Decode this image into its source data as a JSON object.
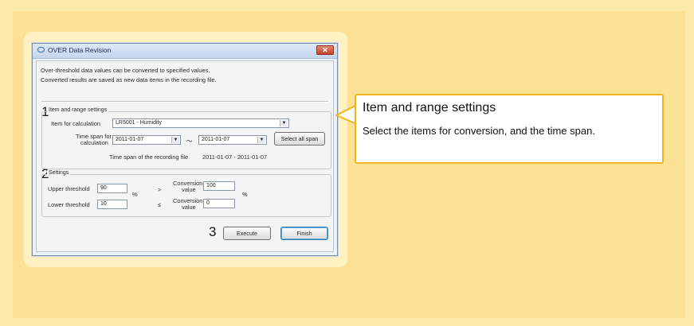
{
  "window": {
    "title": "OVER Data Revision",
    "close_glyph": "✕",
    "intro_line1": "Over-threshold data values can be converted to specified values.",
    "intro_line2": "Converted results are saved as new data items in the recording file."
  },
  "item_range": {
    "step": "1",
    "group_title": "Item and range settings",
    "calc_label": "Item for calculation",
    "calc_value": "LR5001 - Humidity",
    "span_label_1": "Time span for",
    "span_label_2": "calculation",
    "start_date": "2011-01-07",
    "tilde": "〜",
    "end_date": "2011-01-07",
    "select_all_label": "Select all span",
    "recording_span_label": "Time span of the recording file",
    "recording_span_value": "2011-01-07 - 2011-01-07"
  },
  "settings": {
    "step": "2",
    "group_title": "Settings",
    "upper_label": "Upper threshold",
    "upper_value": "90",
    "upper_cmp": ">",
    "upper_conv_label_1": "Conversion",
    "upper_conv_label_2": "value",
    "upper_conv_value": "100",
    "lower_label": "Lower threshold",
    "lower_value": "10",
    "lower_cmp": "≤",
    "lower_conv_label_1": "Conversion",
    "lower_conv_label_2": "value",
    "lower_conv_value": "0",
    "unit_upper": "%",
    "unit_lower": "%"
  },
  "actions": {
    "step": "3",
    "execute_label": "Execute",
    "finish_label": "Finish"
  },
  "callout": {
    "title": "Item and range settings",
    "body": "Select the items for conversion, and the time span."
  },
  "colors": {
    "background": "#fbeaa8",
    "panel": "#fde296",
    "callout_border": "#f2b31c"
  }
}
